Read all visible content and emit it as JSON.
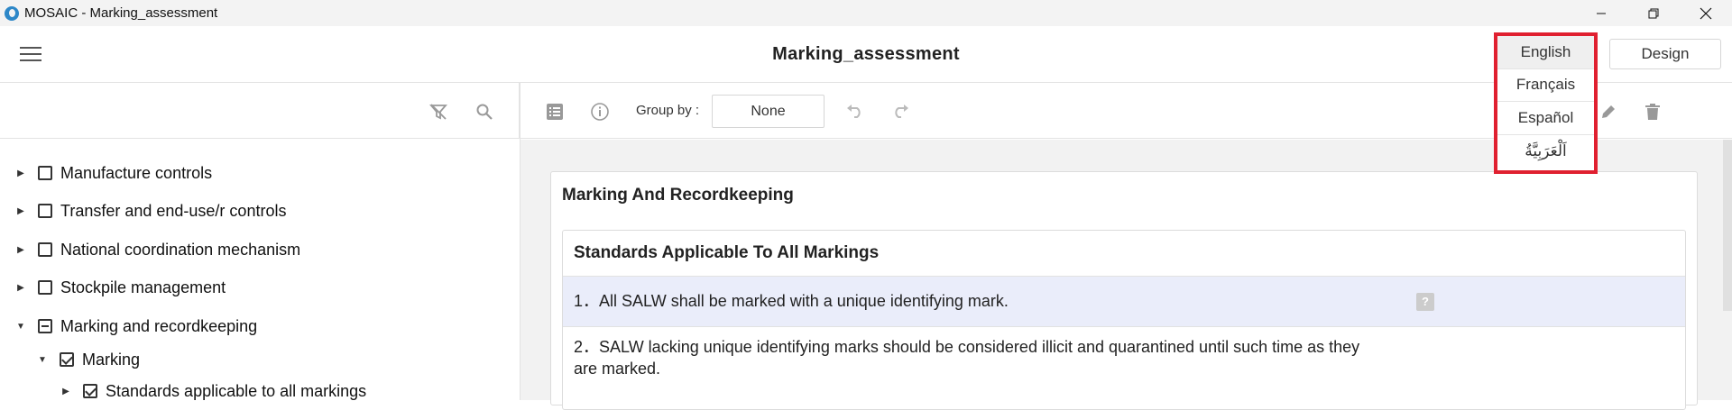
{
  "window": {
    "title": "MOSAIC - Marking_assessment"
  },
  "header": {
    "page_title": "Marking_assessment",
    "design_label": "Design"
  },
  "language_menu": {
    "options": [
      "English",
      "Français",
      "Español",
      "اَلْعَرَبِيَّةُ"
    ],
    "selected": "English"
  },
  "toolbar": {
    "group_by_label": "Group by :",
    "group_by_value": "None"
  },
  "tree": {
    "items": [
      {
        "label": "Manufacture controls",
        "state": "unchecked",
        "expanded": false
      },
      {
        "label": "Transfer and end-use/r controls",
        "state": "unchecked",
        "expanded": false
      },
      {
        "label": "National coordination mechanism",
        "state": "unchecked",
        "expanded": false
      },
      {
        "label": "Stockpile management",
        "state": "unchecked",
        "expanded": false
      },
      {
        "label": "Marking and recordkeeping",
        "state": "indeterminate",
        "expanded": true
      },
      {
        "label": "Marking",
        "state": "checked",
        "expanded": true
      },
      {
        "label": "Standards applicable to all markings",
        "state": "checked",
        "expanded": false
      }
    ]
  },
  "main": {
    "section_title": "Marking And Recordkeeping",
    "subsection_title": "Standards Applicable To All Markings",
    "questions": [
      {
        "text": "1．All SALW shall be marked with a unique identifying mark."
      },
      {
        "text": "2．SALW lacking unique identifying marks should be considered illicit and quarantined until such time as they are marked."
      }
    ],
    "help_symbol": "?"
  },
  "colors": {
    "accent_red": "#e02030",
    "highlight_row": "#eaedfa"
  }
}
